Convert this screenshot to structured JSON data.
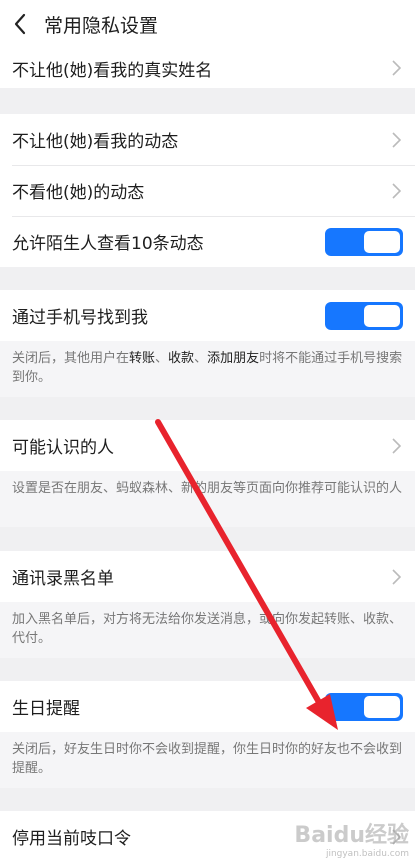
{
  "header": {
    "title": "常用隐私设置"
  },
  "rows": {
    "real_name": "不让他(她)看我的真实姓名",
    "hide_my_moments": "不让他(她)看我的动态",
    "hide_their_moments": "不看他(她)的动态",
    "stranger_10": "允许陌生人查看10条动态",
    "find_by_phone": "通过手机号找到我",
    "maybe_know": "可能认识的人",
    "blacklist": "通讯录黑名单",
    "birthday": "生日提醒",
    "password": "停用当前吱口令"
  },
  "toggles": {
    "stranger_10": true,
    "find_by_phone": true,
    "birthday": true
  },
  "notes": {
    "phone_pre": "关闭后，其他用户在",
    "phone_b1": "转账",
    "phone_sep1": "、",
    "phone_b2": "收款",
    "phone_sep2": "、",
    "phone_b3": "添加朋友",
    "phone_post": "时将不能通过手机号搜索到你。",
    "maybe_know": "设置是否在朋友、蚂蚁森林、新的朋友等页面向你推荐可能认识的人",
    "blacklist": "加入黑名单后，对方将无法给你发送消息，或向你发起转账、收款、代付。",
    "birthday": "关闭后，好友生日时你不会收到提醒，你生日时你的好友也不会收到提醒。"
  },
  "watermark": {
    "text": "Baidu经验",
    "sub": "jingyan.baidu.com"
  },
  "colors": {
    "accent": "#1677ff",
    "arrow": "#e8232d"
  }
}
